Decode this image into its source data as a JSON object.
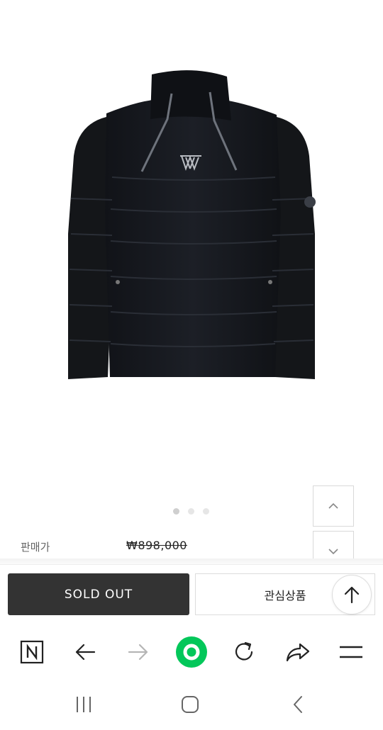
{
  "product": {
    "image_alt": "Black pullover down jacket with twin zippers",
    "carousel": {
      "count": 3,
      "active_index": 0
    },
    "price_label": "판매가",
    "price": "₩898,000"
  },
  "actions": {
    "sold_out_label": "SOLD OUT",
    "wishlist_label": "관심상품"
  },
  "browser_toolbar": {
    "icons": [
      "naver-icon",
      "back-arrow-icon",
      "forward-arrow-icon",
      "home-circle-icon",
      "refresh-icon",
      "share-icon",
      "menu-icon"
    ],
    "accent_color": "#03c75a"
  },
  "system_nav": {
    "icons": [
      "recent-apps-icon",
      "home-icon",
      "back-icon"
    ]
  }
}
